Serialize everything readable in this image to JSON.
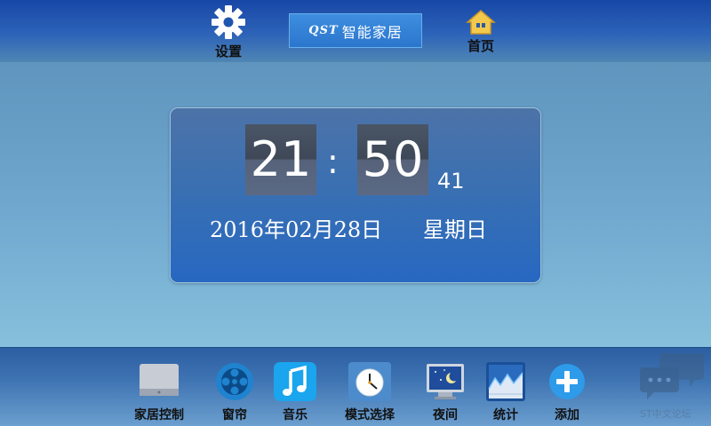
{
  "topbar": {
    "settings_label": "设置",
    "home_label": "首页",
    "brand_mark": "QST",
    "brand_text": "智能家居"
  },
  "clock": {
    "hour": "21",
    "separator": ":",
    "minute": "50",
    "second": "41",
    "date": "2016年02月28日",
    "weekday": "星期日"
  },
  "dock": {
    "items": [
      {
        "label": "家居控制",
        "icon": "monitor-icon"
      },
      {
        "label": "窗帘",
        "icon": "film-reel-icon"
      },
      {
        "label": "音乐",
        "icon": "music-note-icon"
      },
      {
        "label": "模式选择",
        "icon": "clock-icon"
      },
      {
        "label": "夜间",
        "icon": "night-screen-icon"
      },
      {
        "label": "统计",
        "icon": "chart-icon"
      },
      {
        "label": "添加",
        "icon": "plus-icon"
      }
    ]
  },
  "watermark": {
    "text": "ST中文论坛"
  },
  "colors": {
    "topbar": "#1747a6",
    "panel": "#2768c1",
    "dock": "#3e73b2"
  }
}
